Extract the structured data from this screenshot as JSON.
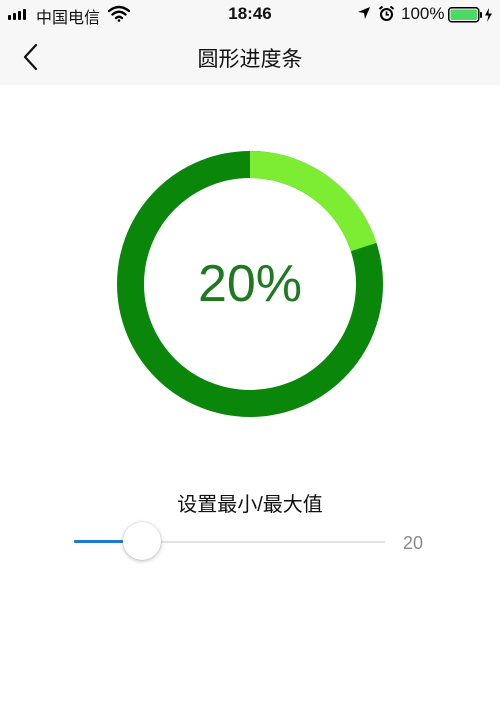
{
  "status_bar": {
    "carrier": "中国电信",
    "time": "18:46",
    "battery_percent": "100%",
    "icons": [
      "signal-icon",
      "wifi-icon",
      "location-arrow-icon",
      "alarm-icon",
      "battery-charging-icon"
    ]
  },
  "nav": {
    "title": "圆形进度条",
    "back_icon": "chevron-left-icon"
  },
  "progress": {
    "label": "20%",
    "value": 0.2,
    "colors": {
      "filled": "#7ded33",
      "remaining": "#0a860a",
      "text": "#1f7a1f"
    }
  },
  "slider": {
    "section_label": "设置最小/最大值",
    "value": 20,
    "min": 0,
    "max": 100,
    "value_label": "20",
    "colors": {
      "fill": "#1d7ad6",
      "track": "#e2e2e2"
    }
  }
}
